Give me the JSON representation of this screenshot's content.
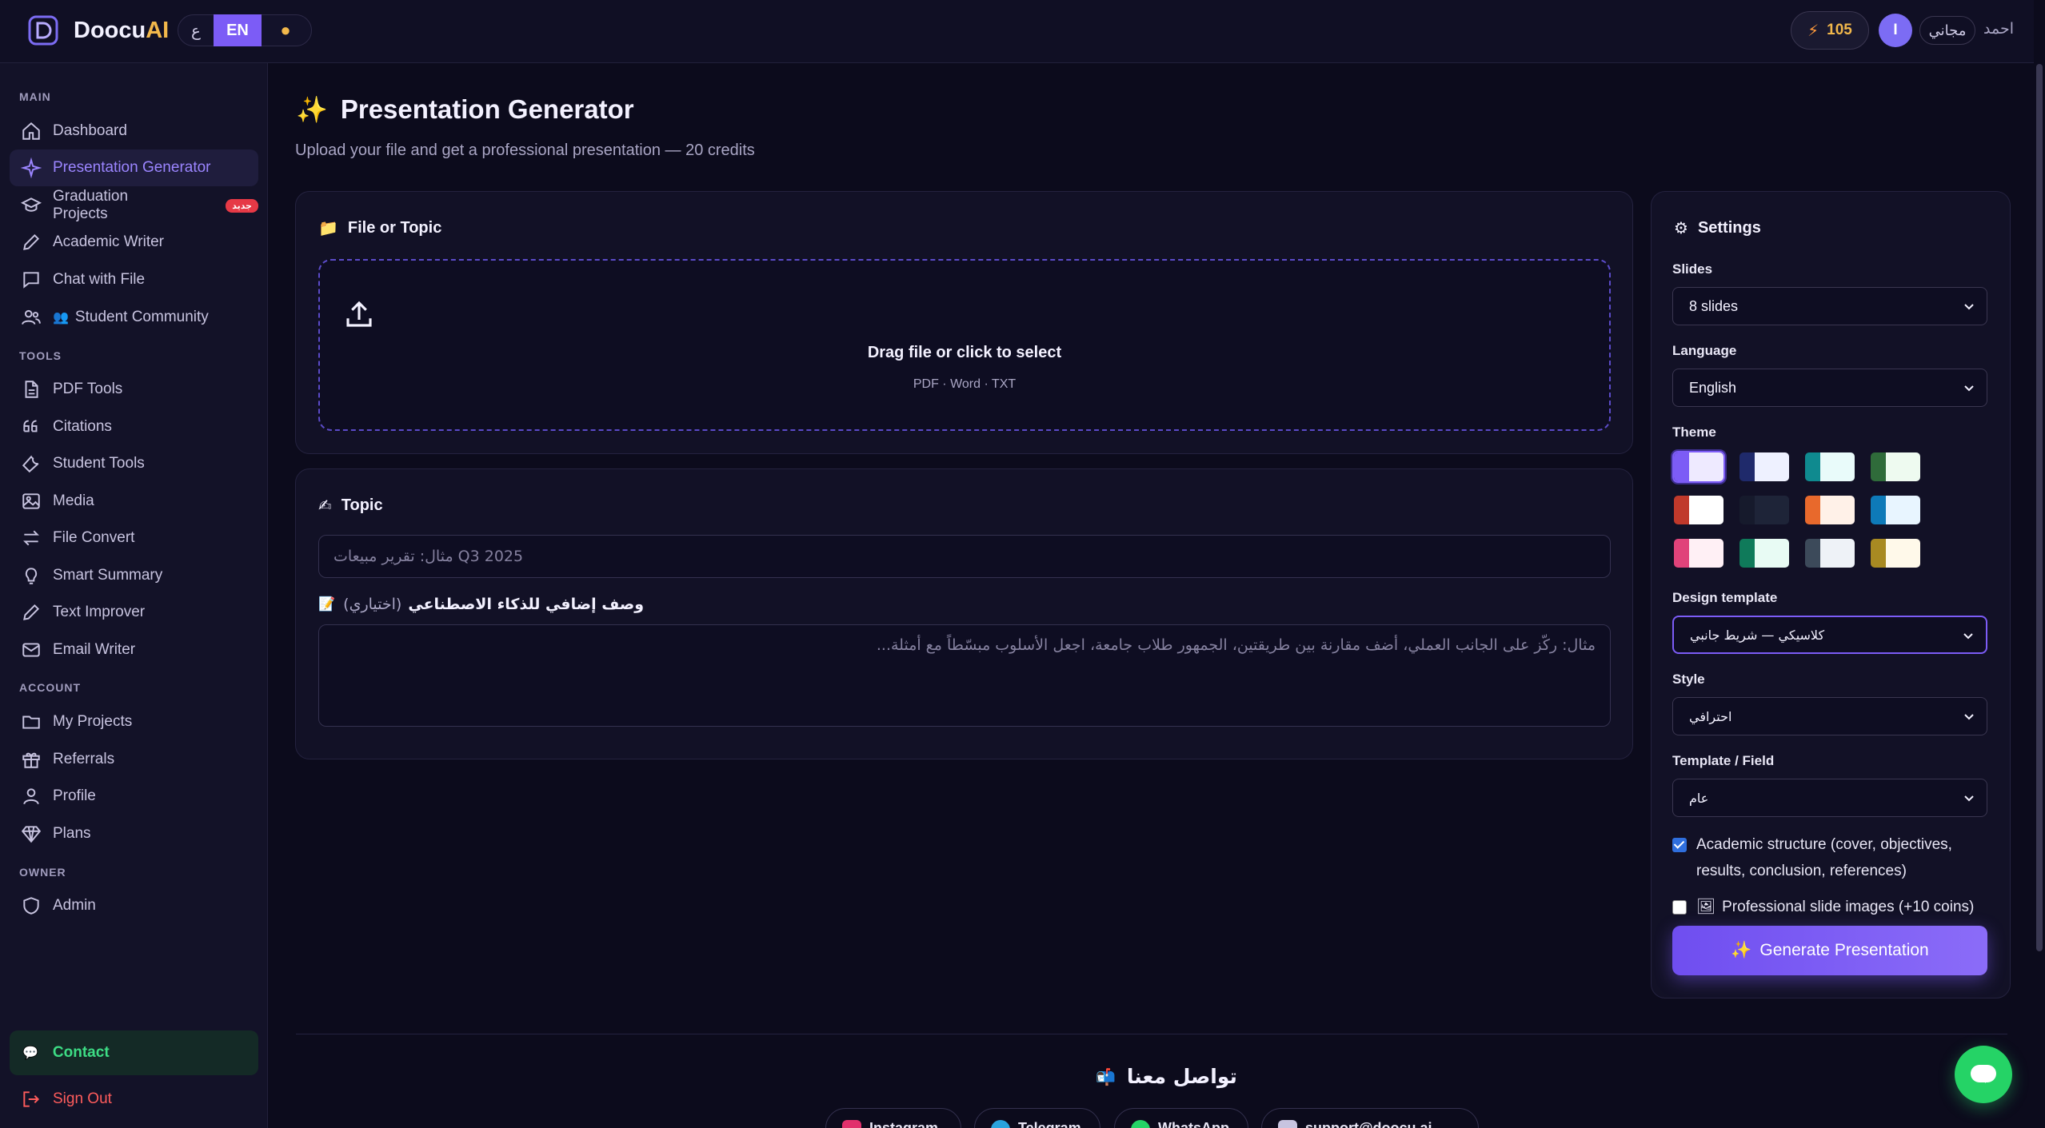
{
  "brand": {
    "name": "Doocu",
    "name_ai": "AI"
  },
  "header": {
    "lang_ar": "ع",
    "lang_en": "EN",
    "theme_icon": "sun-icon",
    "credits": "105",
    "avatar_initial": "I",
    "plan": "مجاني",
    "user_name": "احمد"
  },
  "sidebar": {
    "section_main": "MAIN",
    "section_tools": "TOOLS",
    "section_account": "ACCOUNT",
    "section_owner": "OWNER",
    "items": {
      "dashboard": "Dashboard",
      "presentation": "Presentation Generator",
      "graduation": "Graduation Projects",
      "graduation_badge": "جديد",
      "academic": "Academic Writer",
      "chat_file": "Chat with File",
      "community": "Student Community",
      "pdf": "PDF Tools",
      "citations": "Citations",
      "student_tools": "Student Tools",
      "media": "Media",
      "file_convert": "File Convert",
      "smart_summary": "Smart Summary",
      "text_improver": "Text Improver",
      "email_writer": "Email Writer",
      "my_projects": "My Projects",
      "referrals": "Referrals",
      "profile": "Profile",
      "plans": "Plans",
      "admin": "Admin"
    },
    "contact": "Contact",
    "sign_out": "Sign Out"
  },
  "main": {
    "title": "Presentation Generator",
    "subtitle": "Upload your file and get a professional presentation — 20 credits",
    "file_card": {
      "title": "File or Topic",
      "drop_title": "Drag file or click to select",
      "drop_types": "PDF · Word · TXT"
    },
    "topic_card": {
      "title": "Topic",
      "topic_placeholder": "مثال: تقرير مبيعات Q3 2025",
      "ai_label": "وصف إضافي للذكاء الاصطناعي",
      "ai_optional": "(اختياري)",
      "desc_placeholder": "مثال: ركّز على الجانب العملي، أضف مقارنة بين طريقتين، الجمهور طلاب جامعة، اجعل الأسلوب مبسّطاً مع أمثلة..."
    }
  },
  "settings": {
    "title": "Settings",
    "slides_label": "Slides",
    "slides_value": "8 slides",
    "language_label": "Language",
    "language_value": "English",
    "theme_label": "Theme",
    "themes": [
      {
        "left": "#7c5cf6",
        "right": "#eeeaff"
      },
      {
        "left": "#1f2a6b",
        "right": "#eef1ff"
      },
      {
        "left": "#0f8a8f",
        "right": "#e9fbfa"
      },
      {
        "left": "#2f6b3a",
        "right": "#eefaf0"
      },
      {
        "left": "#c0392b",
        "right": "#ffffff"
      },
      {
        "left": "#161a2c",
        "right": "#1e2438"
      },
      {
        "left": "#e8692c",
        "right": "#fff1e8"
      },
      {
        "left": "#0e7ab8",
        "right": "#e8f5ff"
      },
      {
        "left": "#e0437a",
        "right": "#fff0f5"
      },
      {
        "left": "#0f7a5a",
        "right": "#e8fbf4"
      },
      {
        "left": "#3c4a5a",
        "right": "#eef2f7"
      },
      {
        "left": "#a88a22",
        "right": "#fff9ea"
      }
    ],
    "design_label": "Design template",
    "design_value": "كلاسيكي — شريط جانبي",
    "style_label": "Style",
    "style_value": "احترافي",
    "field_label": "Template / Field",
    "field_value": "عام",
    "academic_check": "Academic structure (cover, objectives, results, conclusion, references)",
    "academic_checked": true,
    "images_check": "Professional slide images (+10 coins)",
    "images_checked": false,
    "generate": "Generate Presentation"
  },
  "footer": {
    "title": "تواصل معنا",
    "socials": [
      {
        "label": "Instagram",
        "color": "#e1306c"
      },
      {
        "label": "Telegram",
        "color": "#2aa3dd"
      },
      {
        "label": "WhatsApp",
        "color": "#25d366"
      },
      {
        "label": "support@doocu.ai",
        "color": "#c8c4e0"
      }
    ]
  }
}
